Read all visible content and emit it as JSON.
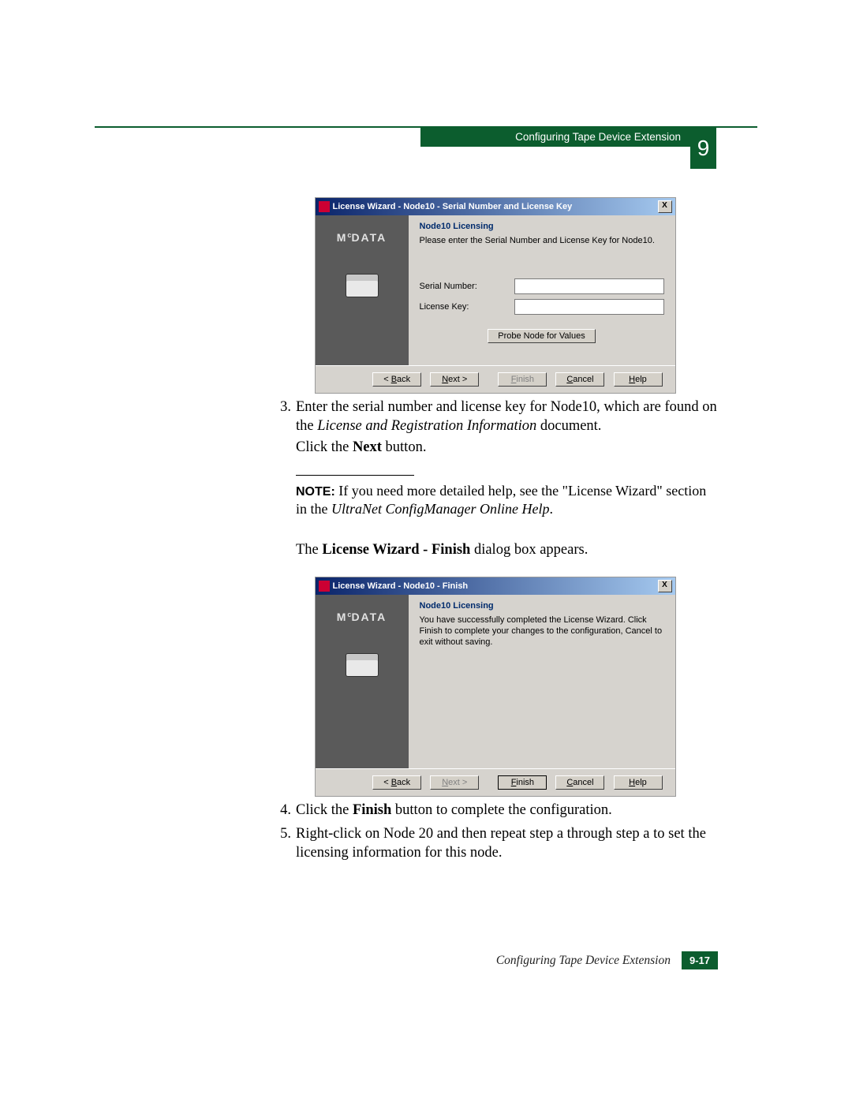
{
  "header": {
    "bar_title": "Configuring Tape Device Extension",
    "chapter_number": "9"
  },
  "dialog1": {
    "title": "License Wizard - Node10 - Serial Number and License Key",
    "close": "X",
    "logo": "McDATA",
    "heading": "Node10 Licensing",
    "instruction": "Please enter the Serial Number and License Key for Node10.",
    "serial_label": "Serial Number:",
    "serial_value": "",
    "key_label": "License Key:",
    "key_value": "",
    "probe_btn": "Probe Node for Values",
    "buttons": {
      "back_prefix": "< ",
      "back_u": "B",
      "back_rest": "ack",
      "next_u": "N",
      "next_rest": "ext >",
      "finish_u": "F",
      "finish_rest": "inish",
      "cancel_u": "C",
      "cancel_rest": "ancel",
      "help_u": "H",
      "help_rest": "elp"
    }
  },
  "step3": {
    "num": "3.",
    "line1a": "Enter the serial number and license key for Node10, which are found on the ",
    "line1_italic": "License and Registration Information",
    "line1b": " document.",
    "line2a": "Click the ",
    "line2_bold": "Next",
    "line2b": " button."
  },
  "note": {
    "label": "NOTE:",
    "text_a": " If you need more detailed help, see the \"License Wizard\" section in the ",
    "text_italic": "UltraNet ConfigManager Online Help",
    "text_b": "."
  },
  "para1": {
    "a": "The ",
    "bold": "License Wizard - Finish",
    "b": " dialog box appears."
  },
  "dialog2": {
    "title": "License Wizard - Node10 - Finish",
    "close": "X",
    "logo": "McDATA",
    "heading": "Node10 Licensing",
    "body": "You have successfully completed the License Wizard. Click Finish to complete your changes to the configuration, Cancel to exit without saving."
  },
  "step4": {
    "num": "4.",
    "a": "Click the ",
    "bold": "Finish",
    "b": " button to complete the configuration."
  },
  "step5": {
    "num": "5.",
    "text": "Right-click on Node 20 and then repeat step a through step a to set the licensing information for this node."
  },
  "footer": {
    "title": "Configuring Tape Device Extension",
    "page": "9-17"
  }
}
